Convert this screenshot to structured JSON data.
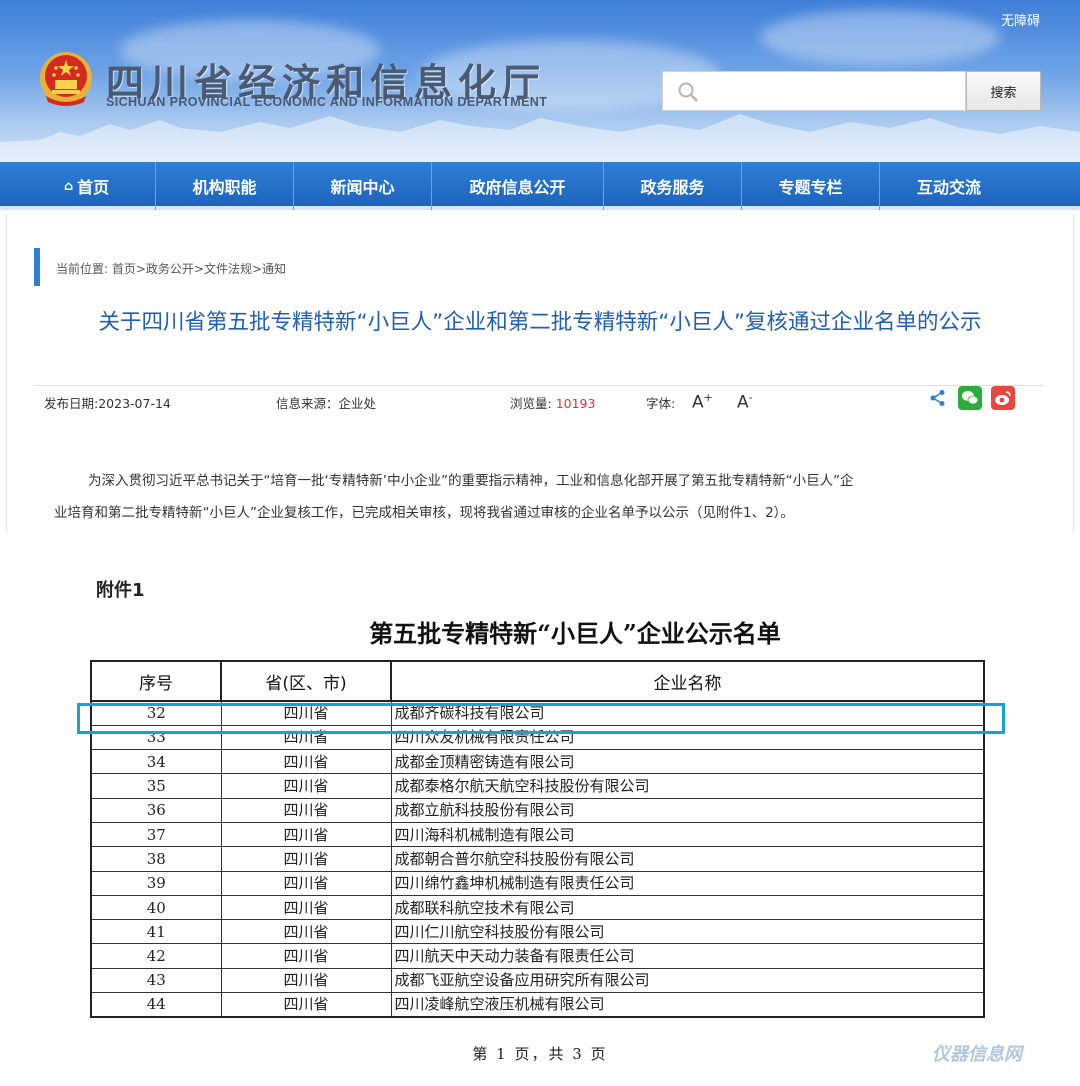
{
  "header": {
    "accessibility": "无障碍",
    "title_cn": "四川省经济和信息化厅",
    "title_en": "SICHUAN PROVINCIAL ECONOMIC AND INFORMATION DEPARTMENT",
    "search_placeholder": "",
    "search_button": "搜索"
  },
  "nav": {
    "items": [
      "首页",
      "机构职能",
      "新闻中心",
      "政府信息公开",
      "政务服务",
      "专题专栏",
      "互动交流"
    ]
  },
  "breadcrumb": "当前位置: 首页>政务公开>文件法规>通知",
  "article": {
    "title": "关于四川省第五批专精特新“小巨人”企业和第二批专精特新“小巨人”复核通过企业名单的公示",
    "date": "发布日期:2023-07-14",
    "source": "信息来源：企业处",
    "views_label": "浏览量:",
    "views": "10193",
    "font_label": "字体:",
    "font_inc": "A",
    "font_dec": "A",
    "para1": "为深入贯彻习近平总书记关于“培育一批‘专精特新’中小企业”的重要指示精神，工业和信息化部开展了第五批专精特新“小巨人”企",
    "para2": "业培育和第二批专精特新“小巨人”企业复核工作，已完成相关审核，现将我省通过审核的企业名单予以公示（见附件1、2）。"
  },
  "document": {
    "attachment": "附件1",
    "title": "第五批专精特新“小巨人”企业公示名单",
    "headers": [
      "序号",
      "省(区、市)",
      "企业名称"
    ],
    "rows": [
      [
        "32",
        "四川省",
        "成都齐碳科技有限公司"
      ],
      [
        "33",
        "四川省",
        "四川众友机械有限责任公司"
      ],
      [
        "34",
        "四川省",
        "成都金顶精密铸造有限公司"
      ],
      [
        "35",
        "四川省",
        "成都泰格尔航天航空科技股份有限公司"
      ],
      [
        "36",
        "四川省",
        "成都立航科技股份有限公司"
      ],
      [
        "37",
        "四川省",
        "四川海科机械制造有限公司"
      ],
      [
        "38",
        "四川省",
        "成都朝合普尔航空科技股份有限公司"
      ],
      [
        "39",
        "四川省",
        "四川绵竹鑫坤机械制造有限责任公司"
      ],
      [
        "40",
        "四川省",
        "成都联科航空技术有限公司"
      ],
      [
        "41",
        "四川省",
        "四川仁川航空科技股份有限公司"
      ],
      [
        "42",
        "四川省",
        "四川航天中天动力装备有限责任公司"
      ],
      [
        "43",
        "四川省",
        "成都飞亚航空设备应用研究所有限公司"
      ],
      [
        "44",
        "四川省",
        "四川凌峰航空液压机械有限公司"
      ]
    ],
    "footer": "第 1 页，共 3 页"
  },
  "watermark": "仪器信息网",
  "colors": {
    "nav_blue": "#1d64bd",
    "title_blue": "#1f5fb4",
    "highlight": "#1aa0d8",
    "views_red": "#dd3333"
  }
}
